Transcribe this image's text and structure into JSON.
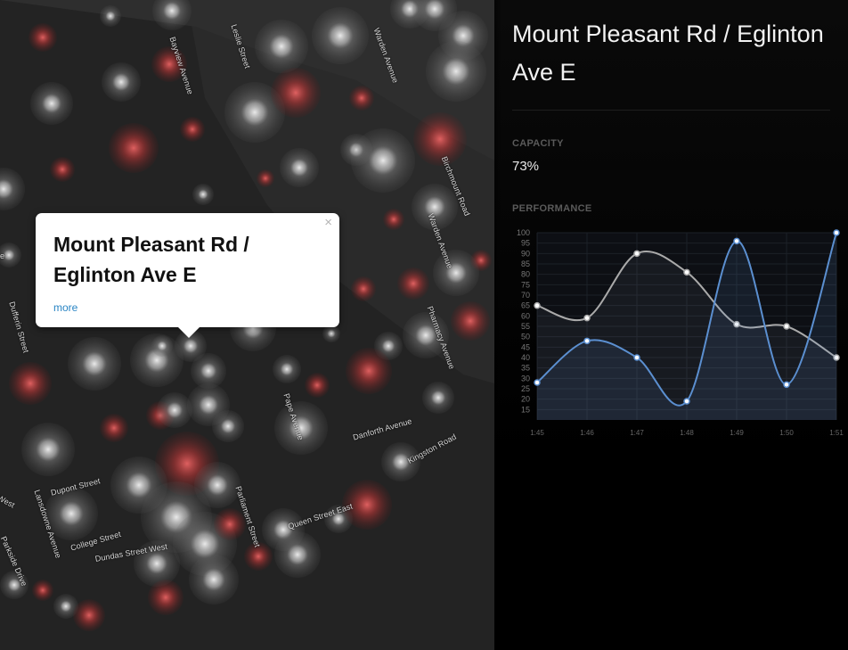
{
  "map": {
    "streets": [
      {
        "name": "Bayview Avenue"
      },
      {
        "name": "Leslie Street"
      },
      {
        "name": "Warden Avenue"
      },
      {
        "name": "Birchmount Road"
      },
      {
        "name": "Warden Avenue"
      },
      {
        "name": "Pharmacy Avenue"
      },
      {
        "name": "Pape Avenue"
      },
      {
        "name": "Danforth Avenue"
      },
      {
        "name": "Kingston Road"
      },
      {
        "name": "Dufferin Street"
      },
      {
        "name": "Dupont Street"
      },
      {
        "name": "Lansdowne Avenue"
      },
      {
        "name": "College Street"
      },
      {
        "name": "Dundas Street West"
      },
      {
        "name": "Parliament Street"
      },
      {
        "name": "Queen Street East"
      },
      {
        "name": "Parkside Drive"
      },
      {
        "name": "West"
      },
      {
        "name": "e"
      }
    ]
  },
  "popup": {
    "title": "Mount Pleasant Rd / Eglinton Ave E",
    "link": "more",
    "close": "×"
  },
  "panel": {
    "title": "Mount Pleasant Rd / Eglinton Ave E",
    "capacity_label": "CAPACITY",
    "capacity_value": "73%",
    "performance_label": "PERFORMANCE"
  },
  "chart_data": {
    "type": "line",
    "categories": [
      "1:45",
      "1:46",
      "1:47",
      "1:48",
      "1:49",
      "1:50",
      "1:51"
    ],
    "yticks": [
      15,
      20,
      25,
      30,
      35,
      40,
      45,
      50,
      55,
      60,
      65,
      70,
      75,
      80,
      85,
      90,
      95,
      100
    ],
    "ylim": [
      10,
      100
    ],
    "series": [
      {
        "values": [
          65,
          59,
          90,
          81,
          56,
          55,
          40
        ],
        "color": "#aaaaaa"
      },
      {
        "values": [
          28,
          48,
          40,
          19,
          96,
          27,
          100
        ],
        "color": "#5b8fd0"
      }
    ],
    "grid": true
  }
}
